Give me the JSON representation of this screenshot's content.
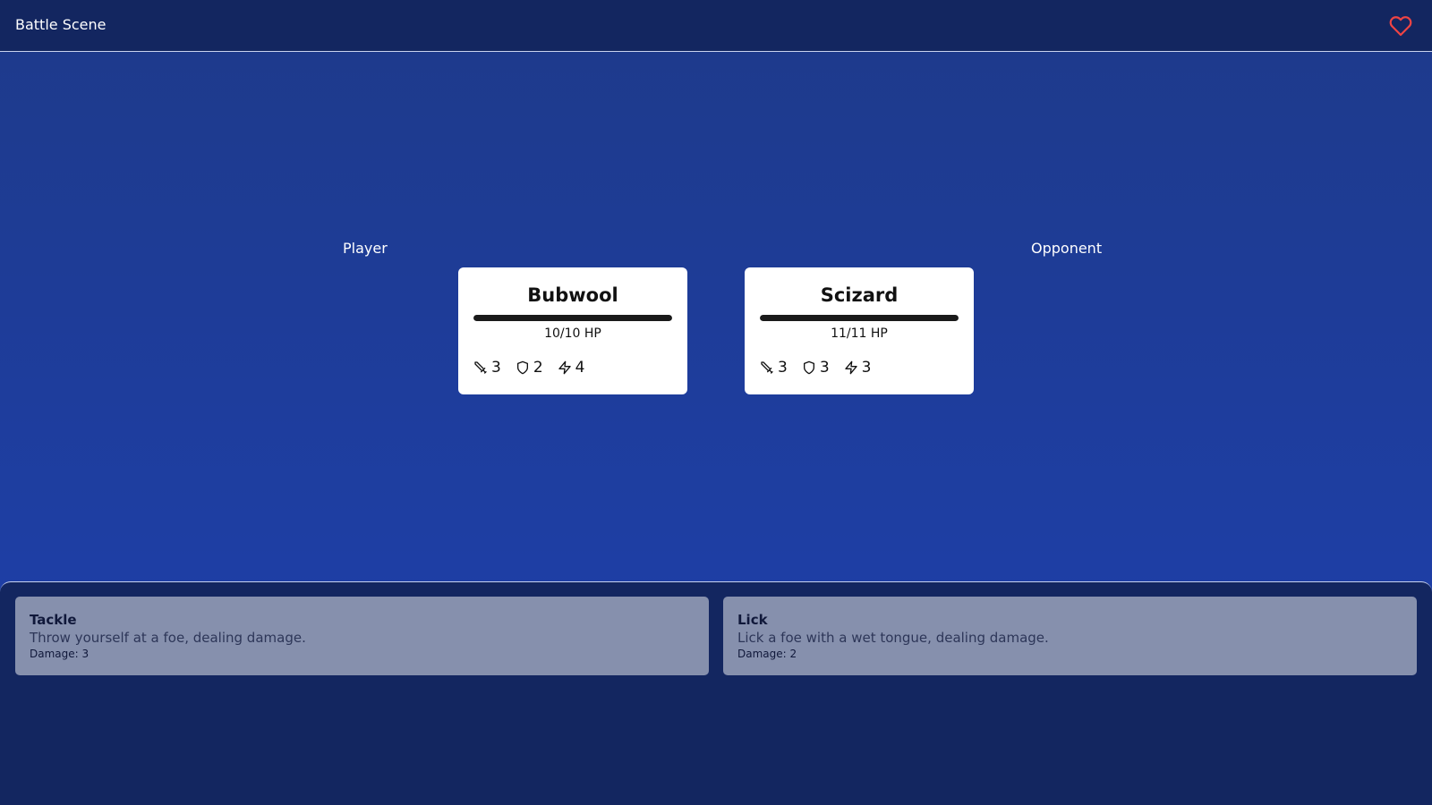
{
  "header": {
    "title": "Battle Scene",
    "favorite_icon": "heart-icon",
    "favorite_color": "#ef4444"
  },
  "player": {
    "label": "Player",
    "name": "Bubwool",
    "hp_text": "10/10 HP",
    "hp_current": 10,
    "hp_max": 10,
    "stats": {
      "attack": "3",
      "defense": "2",
      "speed": "4"
    }
  },
  "opponent": {
    "label": "Opponent",
    "name": "Scizard",
    "hp_text": "11/11 HP",
    "hp_current": 11,
    "hp_max": 11,
    "stats": {
      "attack": "3",
      "defense": "3",
      "speed": "3"
    }
  },
  "moves": [
    {
      "name": "Tackle",
      "description": "Throw yourself at a foe, dealing damage.",
      "damage": "Damage: 3"
    },
    {
      "name": "Lick",
      "description": "Lick a foe with a wet tongue, dealing damage.",
      "damage": "Damage: 2"
    }
  ],
  "icons": {
    "attack": "sword-icon",
    "defense": "shield-icon",
    "speed": "lightning-icon"
  },
  "colors": {
    "background_top": "#1e3a8a",
    "background_bottom": "#1e40af",
    "panel": "#132660",
    "card": "#ffffff",
    "hp_bar": "#1a1a1a",
    "move_button": "#8690ad"
  }
}
